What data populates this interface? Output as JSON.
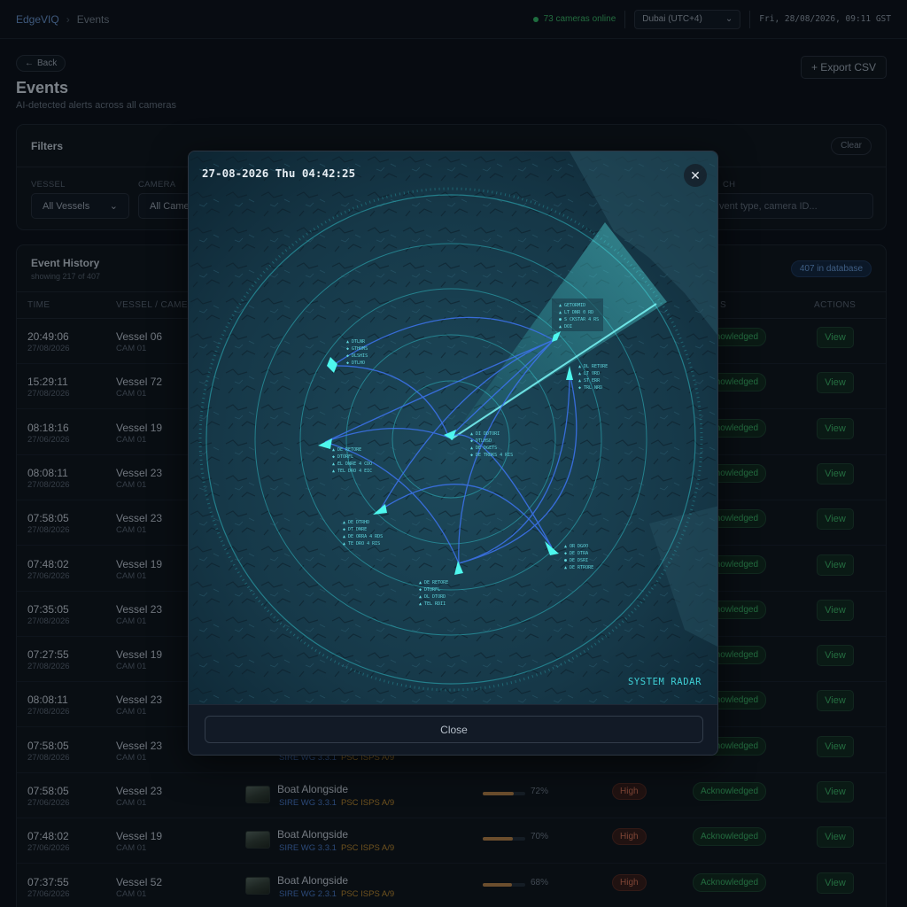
{
  "topbar": {
    "app": "EdgeVIQ",
    "page": "Events",
    "online": "73 cameras online",
    "timezone": "Dubai (UTC+4)",
    "clock": "Fri, 28/08/2026, 09:11 GST"
  },
  "page": {
    "back": "Back",
    "title": "Events",
    "subtitle": "AI-detected alerts across all cameras",
    "export": "+ Export CSV"
  },
  "filters": {
    "title": "Filters",
    "clear": "Clear",
    "vessel_label": "VESSEL",
    "vessel_value": "All Vessels",
    "camera_label": "CAMERA",
    "camera_value": "All Came",
    "search_label": "CH",
    "search_placeholder": "vent type, camera ID..."
  },
  "history": {
    "title": "Event History",
    "showing": "showing 217 of 407",
    "count": "407 in database",
    "columns": [
      "TIME",
      "VESSEL / CAMERA",
      "S",
      "ACTIONS"
    ],
    "rows": [
      {
        "time": "20:49:06",
        "date": "27/08/2026",
        "vessel": "Vessel 06",
        "cam": "CAM 01",
        "status": "Acknowledged",
        "action": "View"
      },
      {
        "time": "15:29:11",
        "date": "27/08/2026",
        "vessel": "Vessel 72",
        "cam": "CAM 01",
        "status": "Acknowledged",
        "action": "View"
      },
      {
        "time": "08:18:16",
        "date": "27/06/2026",
        "vessel": "Vessel 19",
        "cam": "CAM 01",
        "status": "Acknowledged",
        "action": "View"
      },
      {
        "time": "08:08:11",
        "date": "27/08/2026",
        "vessel": "Vessel 23",
        "cam": "CAM 01",
        "status": "Acknowledged",
        "action": "View"
      },
      {
        "time": "07:58:05",
        "date": "27/08/2026",
        "vessel": "Vessel 23",
        "cam": "CAM 01",
        "status": "Acknowledged",
        "action": "View"
      },
      {
        "time": "07:48:02",
        "date": "27/06/2026",
        "vessel": "Vessel 19",
        "cam": "CAM 01",
        "status": "Acknowledged",
        "action": "View"
      },
      {
        "time": "07:35:05",
        "date": "27/08/2026",
        "vessel": "Vessel 23",
        "cam": "CAM 01",
        "status": "Acknowledged",
        "action": "View"
      },
      {
        "time": "07:27:55",
        "date": "27/08/2026",
        "vessel": "Vessel 19",
        "cam": "CAM 01",
        "status": "Acknowledged",
        "action": "View"
      },
      {
        "time": "08:08:11",
        "date": "27/08/2026",
        "vessel": "Vessel 23",
        "cam": "CAM 01",
        "status": "Acknowledged",
        "action": "View"
      },
      {
        "time": "07:58:05",
        "date": "27/08/2026",
        "vessel": "Vessel 23",
        "cam": "CAM 01",
        "status": "Acknowledged",
        "action": "View",
        "tag1": "SIRE WG 3.3.1",
        "tag2": "PSC ISPS A/9"
      },
      {
        "time": "07:58:05",
        "date": "27/06/2026",
        "vessel": "Vessel 23",
        "cam": "CAM 01",
        "type": "Boat Alongside",
        "tag1": "SIRE WG 3.3.1",
        "tag2": "PSC ISPS A/9",
        "confidence": 72,
        "confidence_label": "72%",
        "severity": "High",
        "status": "Acknowledged",
        "action": "View"
      },
      {
        "time": "07:48:02",
        "date": "27/06/2026",
        "vessel": "Vessel 19",
        "cam": "CAM 01",
        "type": "Boat Alongside",
        "tag1": "SIRE WG 3.3.1",
        "tag2": "PSC ISPS A/9",
        "confidence": 70,
        "confidence_label": "70%",
        "severity": "High",
        "status": "Acknowledged",
        "action": "View"
      },
      {
        "time": "07:37:55",
        "date": "27/06/2026",
        "vessel": "Vessel 52",
        "cam": "CAM 01",
        "type": "Boat Alongside",
        "tag1": "SIRE WG 2.3.1",
        "tag2": "PSC ISPS A/9",
        "confidence": 68,
        "confidence_label": "68%",
        "severity": "High",
        "status": "Acknowledged",
        "action": "View"
      }
    ]
  },
  "modal": {
    "timestamp": "27-08-2026 Thu 04:42:25",
    "radar_label": "SYSTEM RADAR",
    "close": "Close",
    "close_icon": "close-icon"
  }
}
